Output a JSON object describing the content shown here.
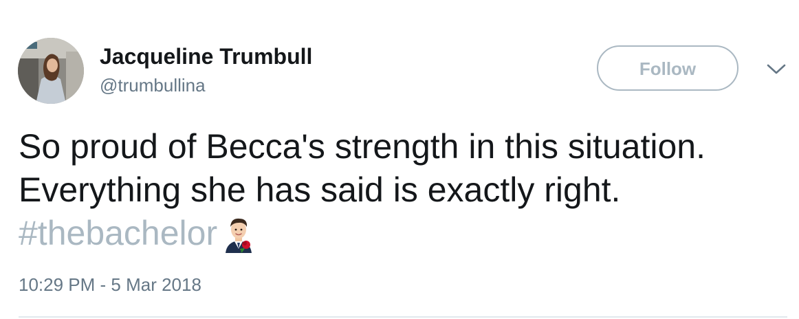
{
  "author": {
    "display_name": "Jacqueline Trumbull",
    "handle": "@trumbullina",
    "avatar_icon": "profile-photo"
  },
  "actions": {
    "follow_label": "Follow",
    "more_icon": "chevron-down-icon"
  },
  "tweet": {
    "text": "So proud of Becca's strength in this situation. Everything she has said is exactly right.",
    "hashtag": "#thebachelor",
    "emoji": "bachelor-rose-emoji",
    "timestamp": "10:29 PM - 5 Mar 2018"
  },
  "colors": {
    "text": "#14171a",
    "secondary": "#657786",
    "muted_link": "#aab8c2",
    "divider": "#e1e8ed"
  }
}
